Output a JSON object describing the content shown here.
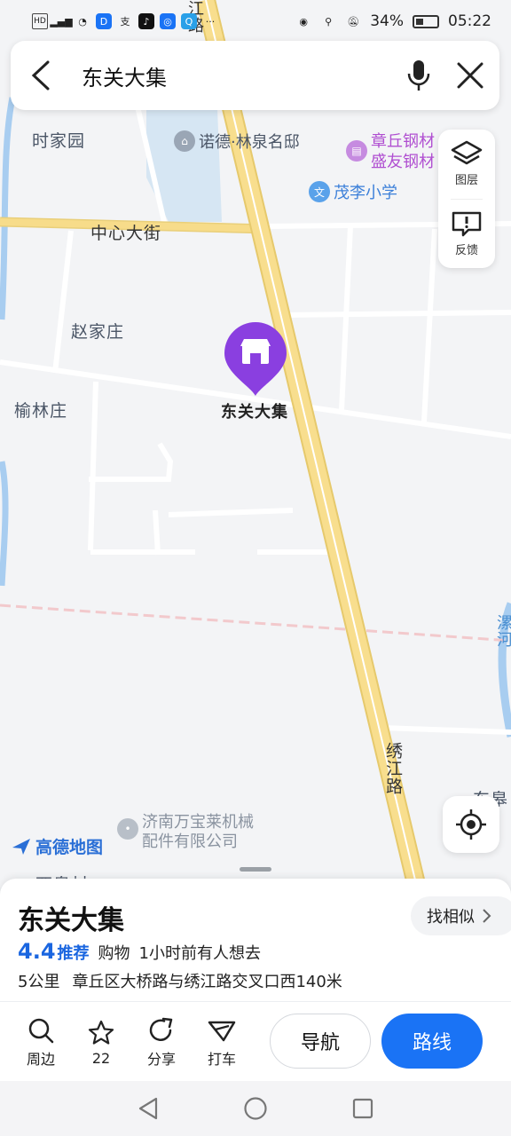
{
  "status_bar": {
    "left_icons": [
      "hd-icon",
      "signal-4g-icon",
      "wifi-icon",
      "app-d-icon",
      "alipay-icon",
      "tiktok-icon",
      "lightbulb-icon",
      "search-app-icon",
      "more-dots-icon"
    ],
    "battery": "34%",
    "time": "05:22"
  },
  "search": {
    "query": "东关大集"
  },
  "side_tools": {
    "layers_label": "图层",
    "feedback_label": "反馈"
  },
  "map": {
    "labels": {
      "shijiayuan": "时家园",
      "nuode": "诺德·林泉名邸",
      "zhangqiu_steel_1": "章丘钢材",
      "zhangqiu_steel_2": "盛友钢材",
      "maoli_school": "茂李小学",
      "zhongxin_street": "中心大街",
      "zhaojiazhuang": "赵家庄",
      "yulinzhuang": "榆林庄",
      "marker_label": "东关大集",
      "xiujiang_road": "绣江路",
      "jiang_road_top": "江路",
      "river": "漯河",
      "dongfu": "东皋",
      "wanbaolai_1": "济南万宝莱机械",
      "wanbaolai_2": "配件有限公司",
      "xifucun": "西皋村"
    },
    "logo": "高德地图"
  },
  "panel": {
    "name": "东关大集",
    "similar": "找相似",
    "rating": "4.4",
    "rating_tag": "推荐",
    "category": "购物",
    "recent": "1小时前有人想去",
    "distance": "5公里",
    "address": "章丘区大桥路与绣江路交叉口西140米",
    "actions": {
      "nearby": "周边",
      "favorite_count": "22",
      "share": "分享",
      "taxi": "打车",
      "navigate": "导航",
      "route": "路线"
    }
  },
  "colors": {
    "accent_blue": "#1a73f5",
    "marker_purple": "#8a3fe0",
    "road_yellow": "#f7dc8a",
    "water_blue": "#a8cdf0"
  }
}
